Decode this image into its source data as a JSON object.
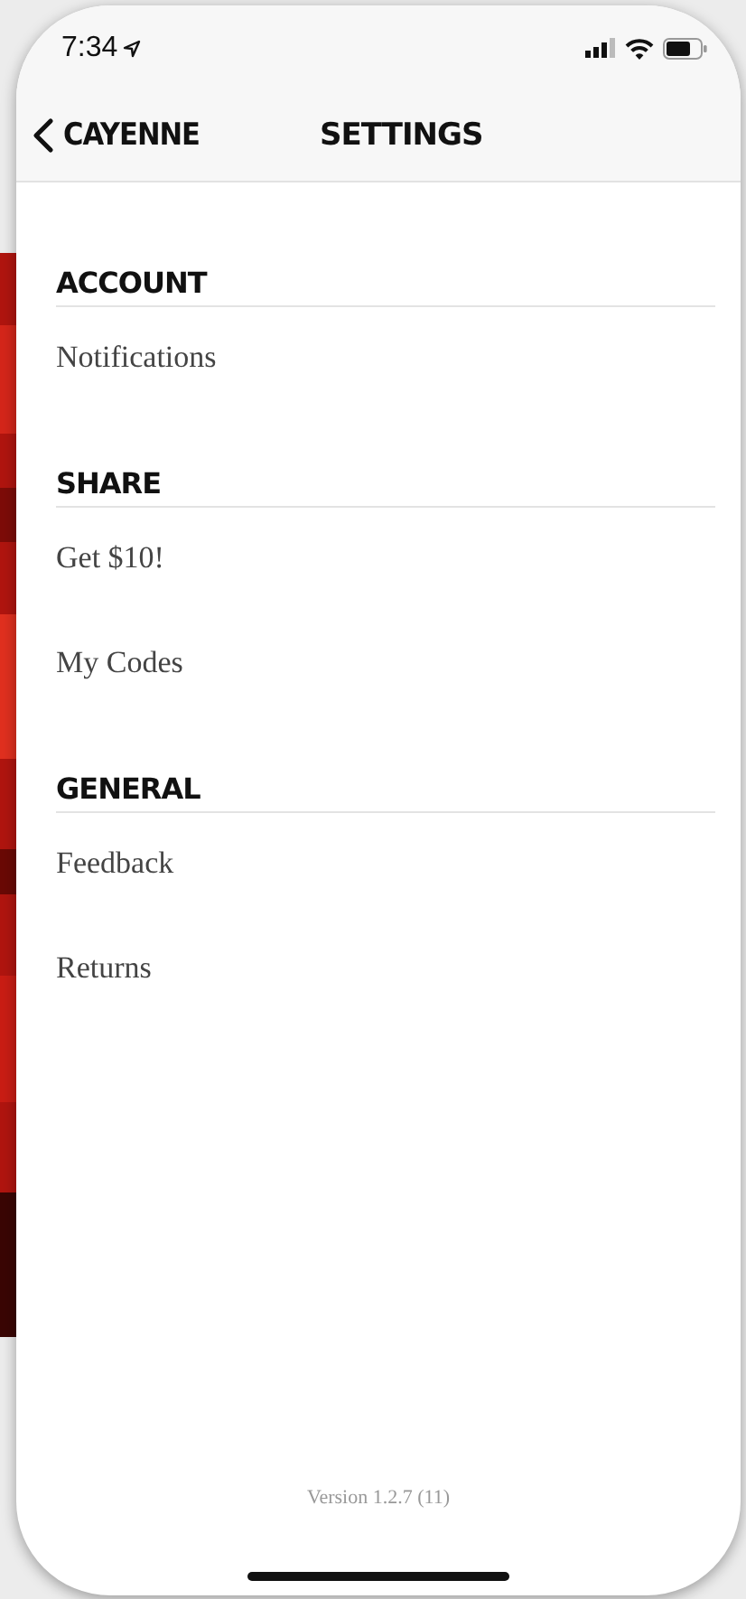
{
  "status_bar": {
    "time": "7:34"
  },
  "nav_bar": {
    "back_label": "CAYENNE",
    "title": "SETTINGS"
  },
  "sections": [
    {
      "title": "ACCOUNT",
      "items": [
        "Notifications"
      ]
    },
    {
      "title": "SHARE",
      "items": [
        "Get $10!",
        "My Codes"
      ]
    },
    {
      "title": "GENERAL",
      "items": [
        "Feedback",
        "Returns"
      ]
    }
  ],
  "footer": {
    "version": "Version 1.2.7 (11)"
  }
}
